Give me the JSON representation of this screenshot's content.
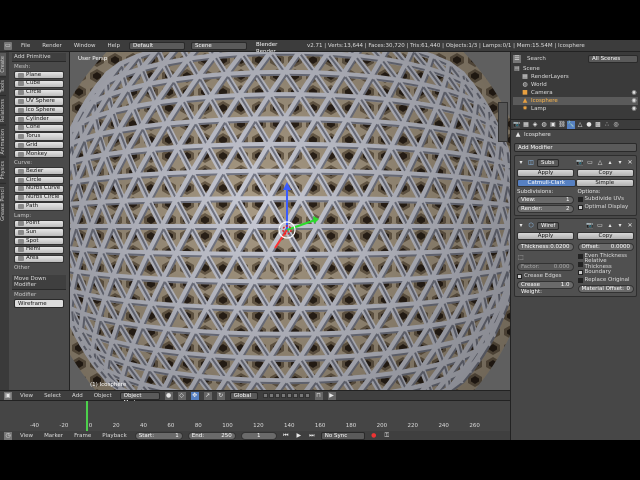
{
  "info_header": {
    "menus": [
      "File",
      "Render",
      "Window",
      "Help"
    ],
    "layout": "Default",
    "scene": "Scene",
    "engine": "Blender Render",
    "stats": "v2.71 | Verts:13,644 | Faces:30,720 | Tris:61,440 | Objects:1/3 | Lamps:0/1 | Mem:15.54M | Icosphere"
  },
  "toolshelf": {
    "tabs": [
      "Create",
      "Tools",
      "Relations",
      "Animation",
      "Physics",
      "Grease Pencil"
    ],
    "title": "Add Primitive",
    "mesh_label": "Mesh:",
    "mesh": [
      "Plane",
      "Cube",
      "Circle",
      "UV Sphere",
      "Ico Sphere",
      "Cylinder",
      "Cone",
      "Torus",
      "Grid",
      "Monkey"
    ],
    "curve_label": "Curve:",
    "curve": [
      "Bezier",
      "Circle",
      "Nurbs Curve",
      "Nurbs Circle",
      "Path"
    ],
    "lamp_label": "Lamp:",
    "lamp": [
      "Point",
      "Sun",
      "Spot",
      "Hemi",
      "Area"
    ],
    "other_label": "Other",
    "operator_title": "Move Down Modifier",
    "operator_field_label": "Modifier",
    "operator_field_value": "Wireframe"
  },
  "viewport": {
    "label": "User Persp",
    "object_label": "(1) Icosphere"
  },
  "view3d_header": {
    "menus": [
      "View",
      "Select",
      "Add",
      "Object"
    ],
    "mode": "Object Mode",
    "orientation": "Global"
  },
  "timeline": {
    "ticks": [
      "-40",
      "-20",
      "0",
      "20",
      "40",
      "60",
      "80",
      "100",
      "120",
      "140",
      "160",
      "180",
      "200",
      "220",
      "240",
      "260"
    ],
    "menus": [
      "View",
      "Marker",
      "Frame",
      "Playback"
    ],
    "start_label": "Start:",
    "start": "1",
    "end_label": "End:",
    "end": "250",
    "current": "1",
    "sync": "No Sync"
  },
  "outliner": {
    "header_view": "Search",
    "scenes_dropdown": "All Scenes",
    "items": [
      "Scene",
      "RenderLayers",
      "World",
      "Camera",
      "Icosphere",
      "Lamp"
    ]
  },
  "properties": {
    "object_name": "Icosphere",
    "add_modifier": "Add Modifier",
    "subsurf": {
      "name": "Subs",
      "apply": "Apply",
      "copy": "Copy",
      "catmull": "Catmull-Clark",
      "simple": "Simple",
      "subdivisions_label": "Subdivisions:",
      "view_label": "View:",
      "view_value": "1",
      "render_label": "Render:",
      "render_value": "2",
      "options_label": "Options:",
      "opt1": "Subdivide UVs",
      "opt2": "Optimal Display"
    },
    "wireframe": {
      "name": "Wiref",
      "apply": "Apply",
      "copy": "Copy",
      "thickness_label": "Thickness:",
      "thickness": "0.0200",
      "offset_label": "Offset:",
      "offset": "0.0000",
      "even": "Even Thickness",
      "relative": "Relative Thickness",
      "factor_label": "Factor:",
      "factor": "0.000",
      "boundary": "Boundary",
      "crease": "Crease Edges",
      "replace": "Replace Original",
      "crease_weight_label": "Crease Weight:",
      "crease_weight": "1.0",
      "material_offset_label": "Material Offset:",
      "material_offset": "0"
    }
  }
}
